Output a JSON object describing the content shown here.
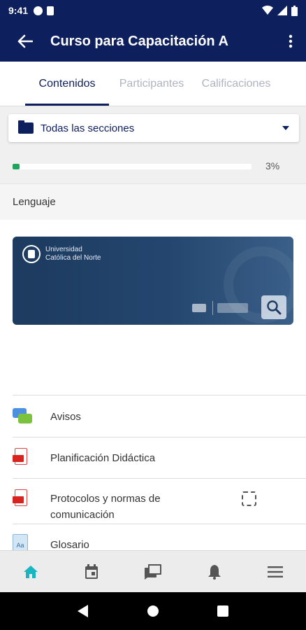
{
  "status_bar": {
    "time": "9:41"
  },
  "app_bar": {
    "title": "Curso para Capacitación A"
  },
  "tabs": [
    {
      "label": "Contenidos",
      "active": true
    },
    {
      "label": "Participantes",
      "active": false
    },
    {
      "label": "Calificaciones",
      "active": false
    }
  ],
  "section_selector": {
    "label": "Todas las secciones"
  },
  "progress": {
    "value": 0.03,
    "label": "3%"
  },
  "section": {
    "name": "Lenguaje"
  },
  "banner": {
    "line1": "Universidad",
    "line2": "Católica del Norte"
  },
  "activities": [
    {
      "name": "Avisos",
      "icon": "forum-icon"
    },
    {
      "name": "Planificación Didáctica",
      "icon": "pdf-icon"
    },
    {
      "name": "Protocolos y normas de",
      "name2": "comunicación",
      "icon": "pdf-icon"
    },
    {
      "name": "Glosario",
      "icon": "glossary-icon"
    }
  ],
  "bottom_nav": [
    {
      "icon": "home-icon",
      "active": true
    },
    {
      "icon": "calendar-icon",
      "active": false
    },
    {
      "icon": "messages-icon",
      "active": false
    },
    {
      "icon": "bell-icon",
      "active": false
    },
    {
      "icon": "menu-icon",
      "active": false
    }
  ],
  "colors": {
    "primary": "#0d1f5c",
    "progress": "#1ea55b",
    "nav_active": "#1ab5c0",
    "nav_inactive": "#555555"
  }
}
